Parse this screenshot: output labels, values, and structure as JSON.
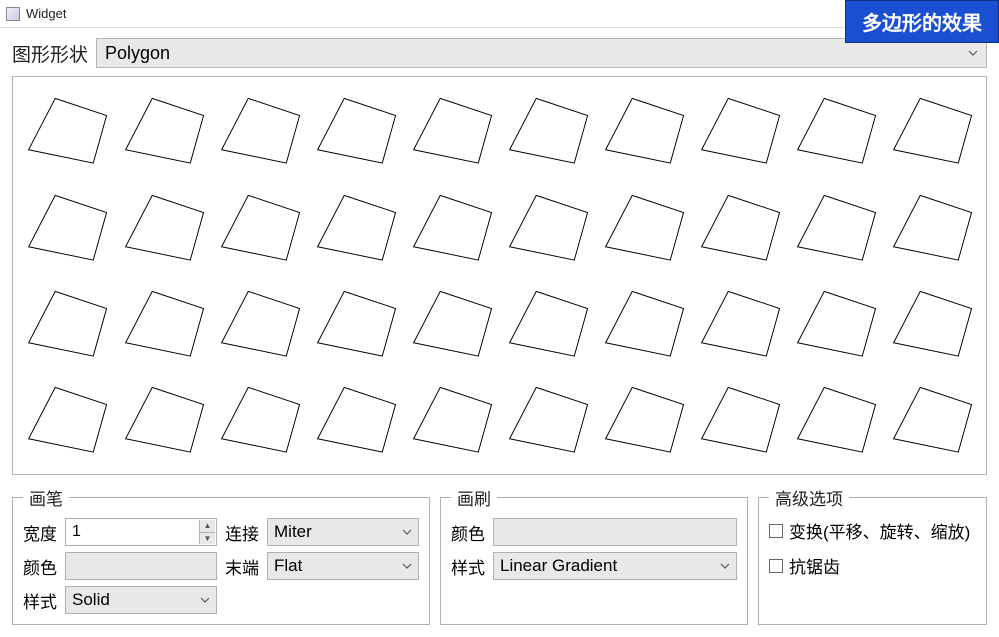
{
  "window": {
    "title": "Widget"
  },
  "banner": {
    "text": "多边形的效果"
  },
  "shape_selector": {
    "label": "图形形状",
    "value": "Polygon"
  },
  "pen": {
    "legend": "画笔",
    "width_label": "宽度",
    "width_value": "1",
    "join_label": "连接",
    "join_value": "Miter",
    "color_label": "颜色",
    "cap_label": "末端",
    "cap_value": "Flat",
    "style_label": "样式",
    "style_value": "Solid"
  },
  "brush": {
    "legend": "画刷",
    "color_label": "颜色",
    "style_label": "样式",
    "style_value": "Linear Gradient"
  },
  "advanced": {
    "legend": "高级选项",
    "transform_label": "变换(平移、旋转、缩放)",
    "antialias_label": "抗锯齿"
  }
}
